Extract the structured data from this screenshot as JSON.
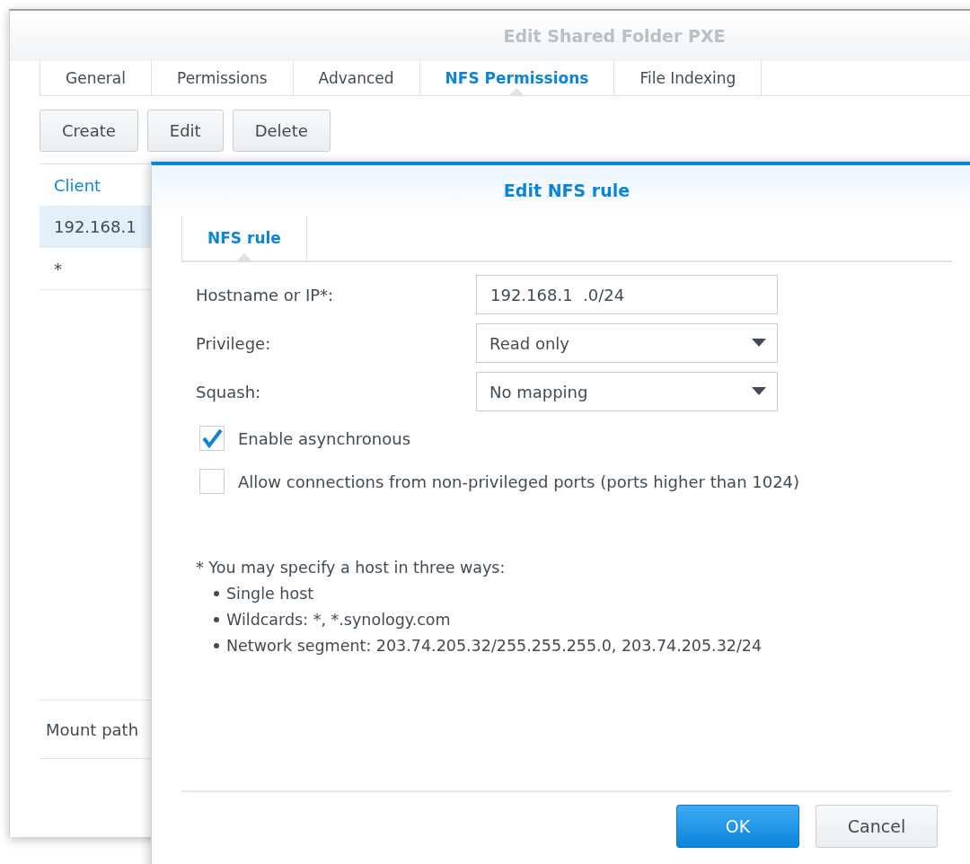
{
  "window": {
    "title": "Edit Shared Folder PXE",
    "tabs": [
      {
        "label": "General",
        "selected": false
      },
      {
        "label": "Permissions",
        "selected": false
      },
      {
        "label": "Advanced",
        "selected": false
      },
      {
        "label": "NFS Permissions",
        "selected": true
      },
      {
        "label": "File Indexing",
        "selected": false
      }
    ],
    "toolbar": [
      "Create",
      "Edit",
      "Delete"
    ],
    "table": {
      "columns": [
        "Client"
      ],
      "rows": [
        {
          "cells": [
            "192.168.1"
          ],
          "selected": true
        },
        {
          "cells": [
            "*"
          ],
          "selected": false
        }
      ]
    },
    "mount_path": {
      "label": "Mount path"
    }
  },
  "dialog": {
    "title": "Edit NFS rule",
    "tabs": [
      {
        "label": "NFS rule",
        "selected": true
      }
    ],
    "fields": [
      {
        "kind": "text",
        "label": "Hostname or IP*:",
        "value": "192.168.1  .0/24"
      },
      {
        "kind": "select",
        "label": "Privilege:",
        "value": "Read only"
      },
      {
        "kind": "select",
        "label": "Squash:",
        "value": "No mapping"
      }
    ],
    "checkboxes": [
      {
        "label": "Enable asynchronous",
        "checked": true
      },
      {
        "label": "Allow connections from non-privileged ports (ports higher than 1024)",
        "checked": false
      }
    ],
    "note": {
      "heading": "* You may specify a host in three ways:",
      "items": [
        "Single host",
        "Wildcards: *, *.synology.com",
        "Network segment: 203.74.205.32/255.255.255.0, 203.74.205.32/24"
      ]
    },
    "buttons": [
      {
        "label": "OK",
        "primary": true
      },
      {
        "label": "Cancel",
        "primary": false
      }
    ]
  }
}
